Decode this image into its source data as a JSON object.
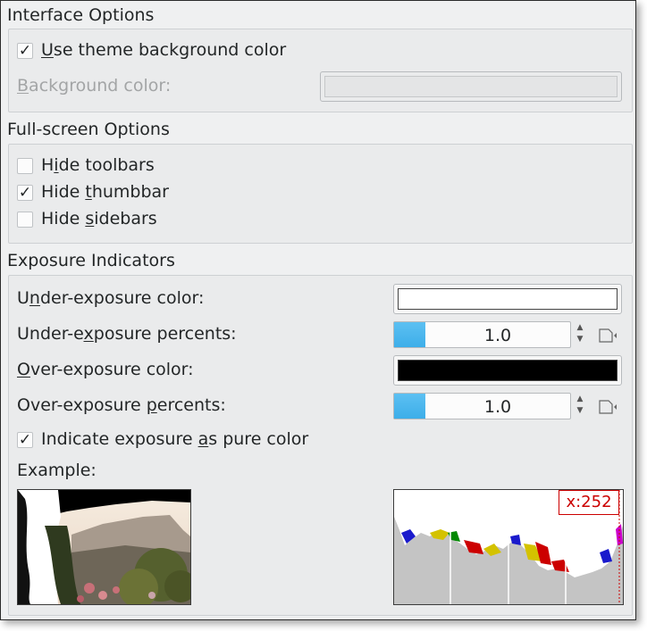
{
  "interface": {
    "title": "Interface Options",
    "theme_bg": {
      "pre": "",
      "u": "U",
      "post": "se theme background color",
      "checked": "✓"
    },
    "bg_color": {
      "pre": "",
      "u": "B",
      "post": "ackground color:"
    }
  },
  "fullscreen": {
    "title": "Full-screen Options",
    "hide_toolbars": {
      "pre": "H",
      "u": "i",
      "post": "de toolbars",
      "checked": ""
    },
    "hide_thumbbar": {
      "pre": "Hide ",
      "u": "t",
      "post": "humbbar",
      "checked": "✓"
    },
    "hide_sidebars": {
      "pre": "Hide ",
      "u": "s",
      "post": "idebars",
      "checked": ""
    }
  },
  "exposure": {
    "title": "Exposure Indicators",
    "under_color": {
      "pre": "U",
      "u": "n",
      "post": "der-exposure color:"
    },
    "under_percents": {
      "pre": "Under-e",
      "u": "x",
      "post": "posure percents:",
      "value": "1.0"
    },
    "over_color": {
      "pre": "",
      "u": "O",
      "post": "ver-exposure color:"
    },
    "over_percents": {
      "pre": "Over-exposure ",
      "u": "p",
      "post": "ercents:",
      "value": "1.0"
    },
    "pure_color": {
      "pre": "Indicate exposure ",
      "u": "a",
      "post": "s pure color",
      "checked": "✓"
    },
    "example_label": "Example:",
    "under_swatch": "#ffffff",
    "over_swatch": "#000000"
  },
  "histogram": {
    "readout": "x:252"
  },
  "colors": {
    "accent": "#3daee9",
    "readout_border": "#cc0000"
  },
  "icons": [
    "checkbox-check-icon",
    "spin-arrows-icon",
    "reset-default-icon"
  ]
}
